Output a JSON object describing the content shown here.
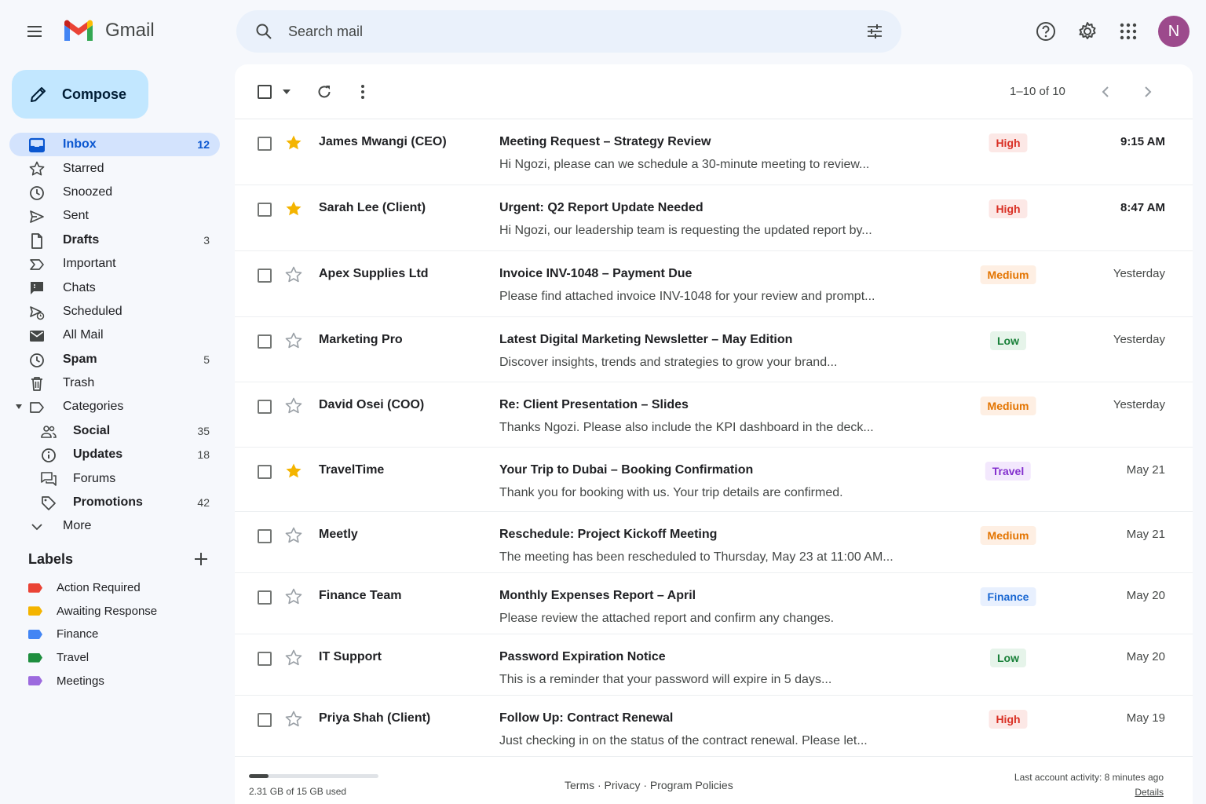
{
  "app": {
    "name": "Gmail"
  },
  "search": {
    "placeholder": "Search mail"
  },
  "account": {
    "avatar_initial": "N"
  },
  "compose": {
    "label": "Compose"
  },
  "nav": {
    "items": [
      {
        "label": "Inbox",
        "count": "12",
        "icon": "inbox-icon",
        "active": true
      },
      {
        "label": "Starred",
        "count": "",
        "icon": "star-outline-icon"
      },
      {
        "label": "Snoozed",
        "count": "",
        "icon": "clock-icon"
      },
      {
        "label": "Sent",
        "count": "",
        "icon": "send-icon"
      },
      {
        "label": "Drafts",
        "count": "3",
        "icon": "draft-icon",
        "bold": true
      },
      {
        "label": "Important",
        "count": "",
        "icon": "important-icon"
      },
      {
        "label": "Chats",
        "count": "",
        "icon": "chat-icon"
      },
      {
        "label": "Scheduled",
        "count": "",
        "icon": "scheduled-send-icon"
      },
      {
        "label": "All Mail",
        "count": "",
        "icon": "mail-icon"
      },
      {
        "label": "Spam",
        "count": "5",
        "icon": "spam-icon",
        "bold": true
      },
      {
        "label": "Trash",
        "count": "",
        "icon": "trash-icon"
      },
      {
        "label": "Categories",
        "count": "",
        "icon": "label-icon"
      },
      {
        "label": "Social",
        "count": "35",
        "icon": "people-icon",
        "bold": true,
        "sub": true
      },
      {
        "label": "Updates",
        "count": "18",
        "icon": "info-icon",
        "bold": true,
        "sub": true
      },
      {
        "label": "Forums",
        "count": "",
        "icon": "forum-icon",
        "sub": true
      },
      {
        "label": "Promotions",
        "count": "42",
        "icon": "tag-icon",
        "bold": true,
        "sub": true
      },
      {
        "label": "More",
        "count": "",
        "icon": "chevron-down-icon"
      }
    ]
  },
  "labels": {
    "title": "Labels",
    "items": [
      {
        "name": "Action Required",
        "color": "#ea4335"
      },
      {
        "name": "Awaiting Response",
        "color": "#f4b400"
      },
      {
        "name": "Finance",
        "color": "#4285f4"
      },
      {
        "name": "Travel",
        "color": "#1e8e3e"
      },
      {
        "name": "Meetings",
        "color": "#9c6ade"
      }
    ]
  },
  "toolbar": {
    "pager": "1–10 of 10"
  },
  "badge_colors": {
    "High": {
      "bg": "#fce8e6",
      "fg": "#d93025"
    },
    "Medium": {
      "bg": "#feefe3",
      "fg": "#e37400"
    },
    "Low": {
      "bg": "#e6f4ea",
      "fg": "#188038"
    },
    "Travel": {
      "bg": "#f3e8fd",
      "fg": "#8430ce"
    },
    "Finance": {
      "bg": "#e8f0fe",
      "fg": "#1967d2"
    }
  },
  "emails": [
    {
      "sender": "James Mwangi (CEO)",
      "subject": "Meeting Request – Strategy Review",
      "snippet": "Hi Ngozi, please can we schedule a 30-minute meeting to review...",
      "badge": "High",
      "time": "9:15 AM",
      "starred": true,
      "unread": true
    },
    {
      "sender": "Sarah Lee (Client)",
      "subject": "Urgent: Q2 Report Update Needed",
      "snippet": "Hi Ngozi, our leadership team is requesting the updated report by...",
      "badge": "High",
      "time": "8:47 AM",
      "starred": true,
      "unread": true
    },
    {
      "sender": "Apex Supplies Ltd",
      "subject": "Invoice INV-1048 – Payment Due",
      "snippet": "Please find attached invoice INV-1048 for your review and prompt...",
      "badge": "Medium",
      "time": "Yesterday",
      "starred": false,
      "unread": false
    },
    {
      "sender": "Marketing Pro",
      "subject": "Latest Digital Marketing Newsletter – May Edition",
      "snippet": "Discover insights, trends and strategies to grow your brand...",
      "badge": "Low",
      "time": "Yesterday",
      "starred": false,
      "unread": false
    },
    {
      "sender": "David Osei (COO)",
      "subject": "Re: Client Presentation – Slides",
      "snippet": "Thanks Ngozi. Please also include the KPI dashboard in the deck...",
      "badge": "Medium",
      "time": "Yesterday",
      "starred": false,
      "unread": false
    },
    {
      "sender": "TravelTime",
      "subject": "Your Trip to Dubai – Booking Confirmation",
      "snippet": "Thank you for booking with us. Your trip details are confirmed.",
      "badge": "Travel",
      "time": "May 21",
      "starred": true,
      "unread": false
    },
    {
      "sender": "Meetly",
      "subject": "Reschedule: Project Kickoff Meeting",
      "snippet": "The meeting has been rescheduled to Thursday, May 23 at 11:00 AM...",
      "badge": "Medium",
      "time": "May 21",
      "starred": false,
      "unread": false
    },
    {
      "sender": "Finance Team",
      "subject": "Monthly Expenses Report – April",
      "snippet": "Please review the attached report and confirm any changes.",
      "badge": "Finance",
      "time": "May 20",
      "starred": false,
      "unread": false
    },
    {
      "sender": "IT Support",
      "subject": "Password Expiration Notice",
      "snippet": "This is a reminder that your password will expire in 5 days...",
      "badge": "Low",
      "time": "May 20",
      "starred": false,
      "unread": false
    },
    {
      "sender": "Priya Shah (Client)",
      "subject": "Follow Up: Contract Renewal",
      "snippet": "Just checking in on the status of the contract renewal. Please let...",
      "badge": "High",
      "time": "May 19",
      "starred": false,
      "unread": false
    }
  ],
  "footer": {
    "storage_text": "2.31 GB of 15 GB used",
    "storage_fraction": 0.154,
    "links": "Terms · Privacy · Program Policies",
    "activity": "Last account activity: 8 minutes ago",
    "details": "Details"
  }
}
